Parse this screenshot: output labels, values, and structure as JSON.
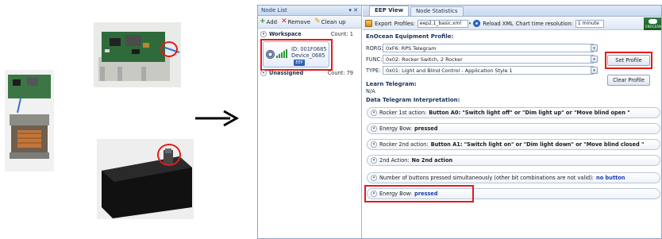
{
  "photos": {
    "pcb_top": "pcb-module-photo",
    "pcb_side": "pcb-stack-photo",
    "black_box": "enclosure-photo"
  },
  "arrow": "right-arrow",
  "node_panel": {
    "title": "Node List",
    "pin": "▾ ✕",
    "toolbar": [
      {
        "icon": "+",
        "label": "Add"
      },
      {
        "icon": "✕",
        "label": "Remove"
      },
      {
        "icon": "✎",
        "label": "Clean up"
      }
    ],
    "workspace": {
      "name": "Workspace",
      "count": "Count: 1"
    },
    "device": {
      "id": "ID: 001F0685",
      "name": "Device_0685",
      "badge": "EEP"
    },
    "unassigned": {
      "name": "Unassigned",
      "count": "Count: 79"
    }
  },
  "tabs": [
    {
      "label": "EEP View",
      "active": true
    },
    {
      "label": "Node Statistics",
      "active": false
    }
  ],
  "toolbar": {
    "export_label": "Export",
    "profiles_label": "Profiles:",
    "profiles_value": "eep2.1_basic.xml",
    "reload_label": "Reload XML",
    "resolution_label": "Chart time resolution:",
    "resolution_value": "1 minute",
    "logo_text": "ENOCEAN"
  },
  "profile": {
    "heading": "EnOcean Equipment Profile:",
    "rorg_label": "RORG:",
    "rorg_value": "0xF6: RPS Telegram",
    "func_label": "FUNC:",
    "func_value": "0x02: Rocker Switch, 2 Rocker",
    "type_label": "TYPE:",
    "type_value": "0x01: Light and Blind Control - Application Style 1",
    "set_button": "Set Profile",
    "clear_button": "Clear Profile"
  },
  "learn": {
    "heading": "Learn Telegram:",
    "value": "N/A"
  },
  "interpretation": {
    "heading": "Data Telegram Interpretation:",
    "rows": [
      {
        "label": "Rocker 1st action:",
        "value": "Button A0:  \"Switch light off\" or \"Dim light up\" or \"Move blind open \"",
        "blue": false
      },
      {
        "label": "Energy Bow:",
        "value": "pressed",
        "blue": false
      },
      {
        "label": "Rocker 2nd action:",
        "value": "Button A1:  \"Switch light on\" or \"Dim light down\" or \"Move blind closed \"",
        "blue": false
      },
      {
        "label": "2nd Action:",
        "value": "No 2nd action",
        "blue": false
      },
      {
        "label": "Number of buttons pressed simultaneously (other bit combinations are not valid):",
        "value": "no button",
        "blue": true
      },
      {
        "label": "Energy Bow:",
        "value": "pressed",
        "blue": true
      }
    ]
  },
  "colors": {
    "highlight": "#e21b1b",
    "accent": "#15428b"
  }
}
